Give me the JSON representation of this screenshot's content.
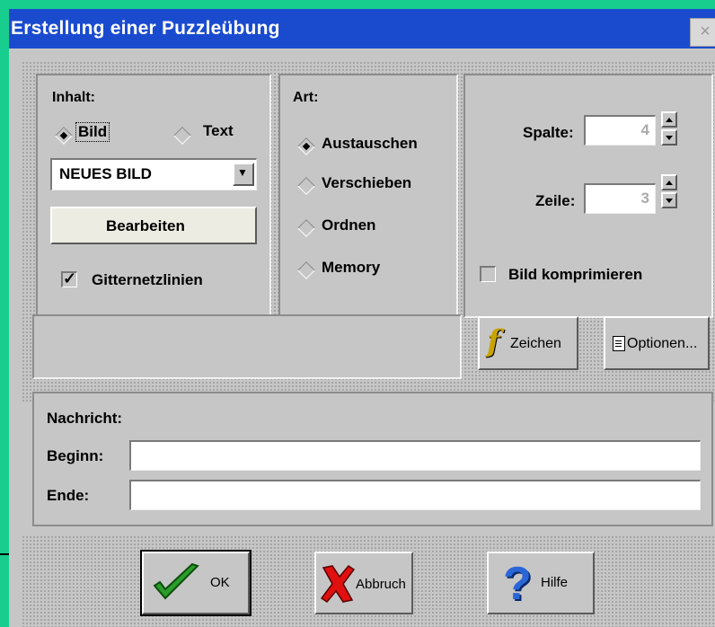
{
  "dialog": {
    "title": "Erstellung einer Puzzleübung",
    "close_glyph": "×"
  },
  "content_group": {
    "label": "Inhalt:",
    "options": [
      {
        "label": "Bild",
        "selected": true
      },
      {
        "label": "Text",
        "selected": false
      }
    ],
    "image_select": {
      "value": "NEUES BILD",
      "arrow": "▼"
    },
    "edit_button": "Bearbeiten",
    "grid_lines": {
      "label": "Gitternetzlinien",
      "checked": true,
      "mark": "✓"
    }
  },
  "type_group": {
    "label": "Art:",
    "options": [
      {
        "label": "Austauschen",
        "selected": true
      },
      {
        "label": "Verschieben",
        "selected": false
      },
      {
        "label": "Ordnen",
        "selected": false
      },
      {
        "label": "Memory",
        "selected": false
      }
    ]
  },
  "size_group": {
    "columns": {
      "label": "Spalte:",
      "value": "4"
    },
    "rows": {
      "label": "Zeile:",
      "value": "3"
    },
    "compress": {
      "label": "Bild komprimieren",
      "checked": false
    }
  },
  "font_button": {
    "icon": "f",
    "label": "Zeichen"
  },
  "options_button": {
    "label": "Optionen..."
  },
  "message": {
    "label": "Nachricht:",
    "begin_label": "Beginn:",
    "begin_value": "",
    "end_label": "Ende:",
    "end_value": ""
  },
  "footer": {
    "ok": {
      "label": "OK",
      "icon": "check-icon"
    },
    "cancel": {
      "label": "Abbruch",
      "icon": "x-icon"
    },
    "help": {
      "label": "Hilfe",
      "icon": "question-icon"
    }
  },
  "colors": {
    "background": "#18ce8e",
    "titlebar": "#1a4bcf",
    "face": "#c6c6c6"
  }
}
